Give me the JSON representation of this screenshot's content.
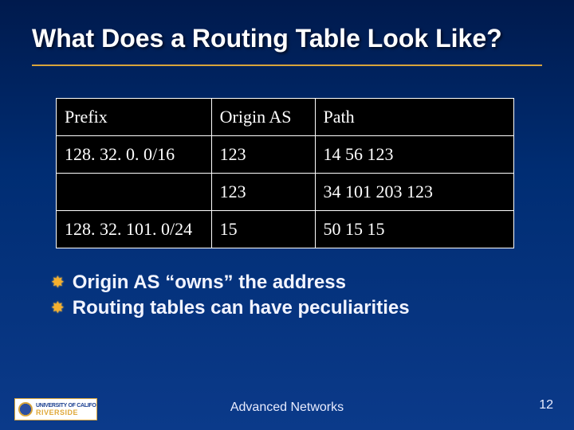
{
  "title": "What Does a Routing Table Look Like?",
  "table": {
    "headers": {
      "prefix": "Prefix",
      "origin": "Origin AS",
      "path": "Path"
    },
    "rows": [
      {
        "prefix": "128. 32. 0. 0/16",
        "origin": "123",
        "path": "14 56 123"
      },
      {
        "prefix": "",
        "origin": "123",
        "path": "34 101 203 123"
      },
      {
        "prefix": "128. 32. 101. 0/24",
        "origin": "15",
        "path": "50 15 15"
      }
    ]
  },
  "bullets": [
    "Origin AS “owns” the address",
    "Routing tables can have peculiarities"
  ],
  "footer": {
    "logo_line1": "UNIVERSITY OF CALIFORNIA",
    "logo_line2": "RIVERSIDE",
    "center": "Advanced Networks",
    "page": "12"
  }
}
